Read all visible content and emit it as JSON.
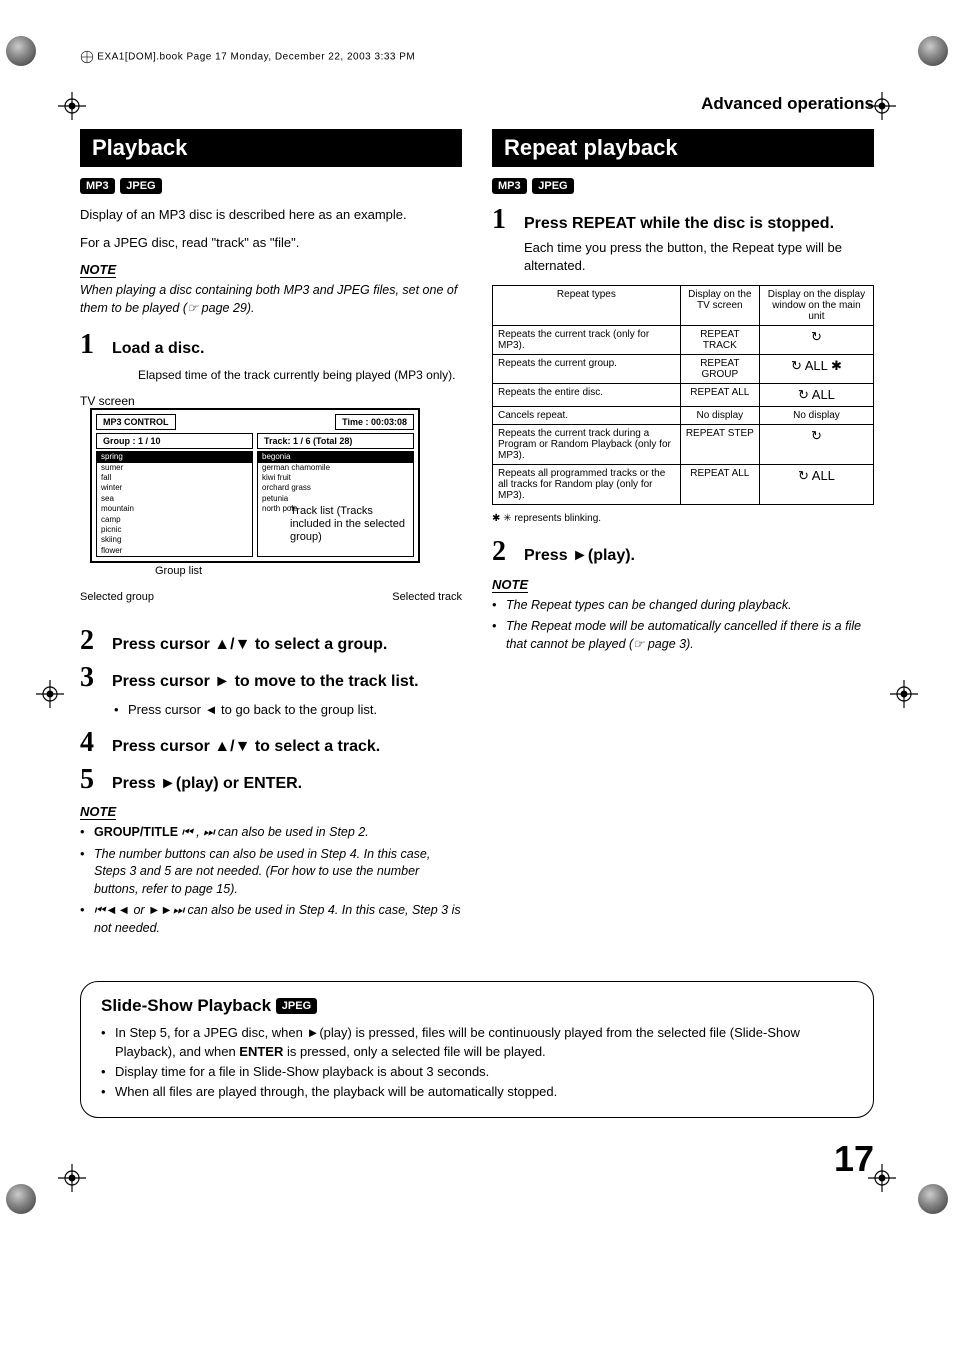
{
  "print_header": "EXA1[DOM].book  Page 17  Monday, December 22, 2003  3:33 PM",
  "breadcrumb": "Advanced operations",
  "left": {
    "section_title": "Playback",
    "badges": [
      "MP3",
      "JPEG"
    ],
    "intro1": "Display of an MP3 disc is described here as an example.",
    "intro2": "For a JPEG disc, read \"track\" as \"file\".",
    "note_label": "NOTE",
    "note1": "When playing a disc containing both MP3 and JPEG files, set one of them to be played (☞ page 29).",
    "step1": "Load a disc.",
    "tv_label": "TV screen",
    "elapsed_label": "Elapsed time of the track currently being played (MP3 only).",
    "diagram": {
      "title": "MP3 CONTROL",
      "time": "Time : 00:03:08",
      "group_header": "Group : 1 / 10",
      "track_header": "Track:  1 / 6 (Total 28)",
      "groups": [
        "spring",
        "sumer",
        "fall",
        "winter",
        "sea",
        "mountain",
        "camp",
        "picnic",
        "skiing",
        "flower"
      ],
      "tracks": [
        "begonia",
        "german chamomile",
        "kiwi fruit",
        "orchard grass",
        "petunia",
        "north pole"
      ],
      "callout_grouplist": "Group list",
      "callout_selectedgroup": "Selected group",
      "callout_tracklist": "Track list (Tracks included in the selected group)",
      "callout_selectedtrack": "Selected track"
    },
    "step2": "Press cursor ▲/▼ to select a group.",
    "step3": "Press cursor ► to move to the track list.",
    "step3_sub": "Press cursor ◄ to go back to the group list.",
    "step4": "Press cursor ▲/▼ to select a track.",
    "step5": "Press ►(play) or ENTER.",
    "note2_label": "NOTE",
    "note2_items": [
      "GROUP/TITLE ⏮ , ⏭ can also be used in Step 2.",
      "The number buttons can also be used in Step 4. In this case, Steps 3 and 5 are not needed. (For how to use the number buttons, refer to page 15).",
      "⏮◄◄ or ►►⏭ can also be used in Step 4. In this case, Step 3 is not needed."
    ]
  },
  "right": {
    "section_title": "Repeat playback",
    "badges": [
      "MP3",
      "JPEG"
    ],
    "step1": "Press REPEAT while the disc is stopped.",
    "step1_sub": "Each time you press the button, the Repeat type will be alternated.",
    "table": {
      "headers": [
        "Repeat types",
        "Display on the TV screen",
        "Display on the display window on the main unit"
      ],
      "rows": [
        {
          "c1": "Repeats the current track (only for MP3).",
          "c2": "REPEAT TRACK",
          "c3": "↻"
        },
        {
          "c1": "Repeats the current group.",
          "c2": "REPEAT GROUP",
          "c3": "↻ ALL ✱"
        },
        {
          "c1": "Repeats the entire disc.",
          "c2": "REPEAT ALL",
          "c3": "↻ ALL"
        },
        {
          "c1": "Cancels repeat.",
          "c2": "No display",
          "c3": "No display"
        },
        {
          "c1": "Repeats the current track during a Program or Random Playback (only for MP3).",
          "c2": "REPEAT STEP",
          "c3": "↻"
        },
        {
          "c1": "Repeats all programmed tracks or the all tracks for Random play (only for MP3).",
          "c2": "REPEAT ALL",
          "c3": "↻ ALL"
        }
      ]
    },
    "footnote": "✱  ✳ represents blinking.",
    "step2": "Press ►(play).",
    "note_label": "NOTE",
    "note_items": [
      "The Repeat types can be changed during playback.",
      "The Repeat mode will be automatically cancelled if there is a file that cannot be played (☞ page 3)."
    ]
  },
  "slideshow": {
    "title": "Slide-Show Playback",
    "badge": "JPEG",
    "items": [
      "In Step 5, for a JPEG disc, when ►(play) is pressed, files will be continuously played from the selected file (Slide-Show Playback), and when ENTER is pressed, only a selected file will be played.",
      "Display time for a file in Slide-Show playback is about 3 seconds.",
      "When all files are played through, the playback will be automatically stopped."
    ],
    "enter_bold": "ENTER"
  },
  "page_number": "17"
}
